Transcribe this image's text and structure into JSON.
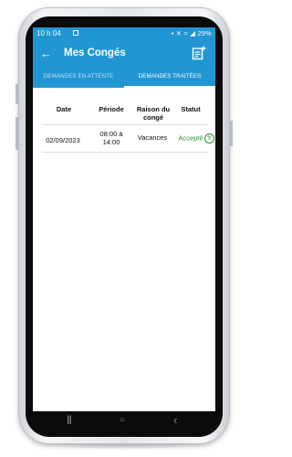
{
  "status_bar": {
    "time": "10 h 04",
    "indicators": "▪ ✕ ≈ ◢ 29%"
  },
  "app_bar": {
    "back_icon": "←",
    "title": "Mes Congés"
  },
  "tabs": [
    {
      "label": "DEMANDES EN ATTENTE",
      "active": false
    },
    {
      "label": "DEMANDES TRAITÉES",
      "active": true
    }
  ],
  "table": {
    "headers": [
      "Date",
      "Période",
      "Raison du congé",
      "Statut"
    ],
    "rows": [
      {
        "date": "02/09/2023",
        "period_from": "08:00 à",
        "period_to": "14:00",
        "reason": "Vacances",
        "status": "Accepté",
        "help_icon": "?"
      }
    ]
  },
  "navigation": {
    "recents": "|||",
    "home": "○",
    "back": "‹"
  },
  "colors": {
    "primary": "#2196d3",
    "accepted": "#2e8b2e"
  }
}
